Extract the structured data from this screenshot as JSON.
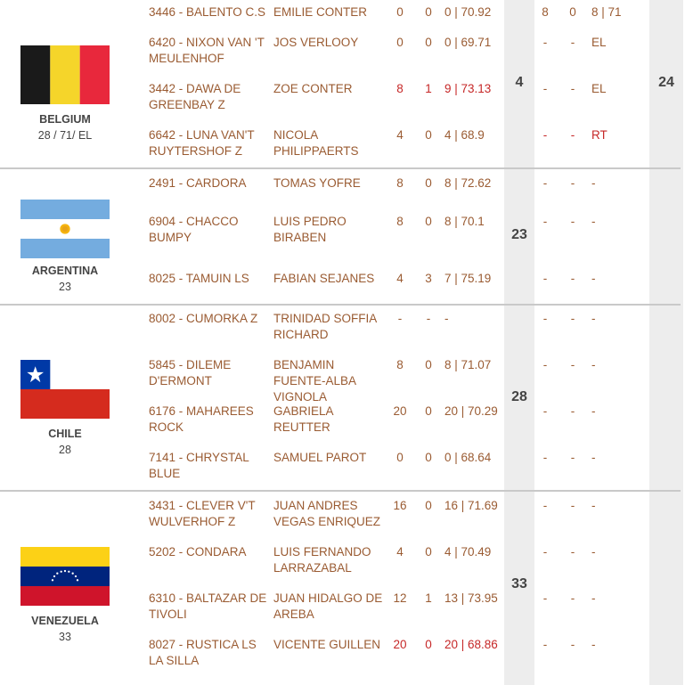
{
  "teams": [
    {
      "country": "BELGIUM",
      "score_line": "28 / 71/ EL",
      "round_score": "4",
      "total_score": "24",
      "riders": [
        {
          "horse": "3446 - BALENTO C.S",
          "rider": "EMILIE CONTER",
          "n1": "0",
          "n2": "0",
          "n3": "0 | 70.92",
          "m1": "8",
          "m2": "0",
          "m3": "8 | 71"
        },
        {
          "horse": "6420 - NIXON VAN 'T MEULENHOF",
          "rider": "JOS VERLOOY",
          "n1": "0",
          "n2": "0",
          "n3": "0 | 69.71",
          "m1": "-",
          "m2": "-",
          "m3": "EL"
        },
        {
          "horse": "3442 - DAWA DE GREENBAY Z",
          "rider": "ZOE CONTER",
          "n1": "8",
          "n2": "1",
          "n3": "9 | 73.13",
          "m1": "-",
          "m2": "-",
          "m3": "EL"
        },
        {
          "horse": "6642 - LUNA VAN'T RUYTERSHOF Z",
          "rider": "NICOLA PHILIPPAERTS",
          "n1": "4",
          "n2": "0",
          "n3": "4 | 68.9",
          "m1": "-",
          "m2": "-",
          "m3": "RT"
        }
      ]
    },
    {
      "country": "ARGENTINA",
      "score_line": "23",
      "round_score": "23",
      "riders": [
        {
          "horse": "2491 - CARDORA",
          "rider": "TOMAS YOFRE",
          "n1": "8",
          "n2": "0",
          "n3": "8 | 72.62",
          "m1": "-",
          "m2": "-",
          "m3": "-"
        },
        {
          "horse": "6904 - CHACCO BUMPY",
          "rider": "LUIS PEDRO BIRABEN",
          "n1": "8",
          "n2": "0",
          "n3": "8 | 70.1",
          "m1": "-",
          "m2": "-",
          "m3": "-"
        },
        {
          "horse": "8025 - TAMUIN LS",
          "rider": "FABIAN SEJANES",
          "n1": "4",
          "n2": "3",
          "n3": "7 | 75.19",
          "m1": "-",
          "m2": "-",
          "m3": "-"
        }
      ]
    },
    {
      "country": "CHILE",
      "score_line": "28",
      "round_score": "28",
      "riders": [
        {
          "horse": "8002 - CUMORKA Z",
          "rider": "TRINIDAD SOFFIA RICHARD",
          "n1": "-",
          "n2": "-",
          "n3": "-",
          "m1": "-",
          "m2": "-",
          "m3": "-"
        },
        {
          "horse": "5845 - DILEME D'ERMONT",
          "rider": "BENJAMIN FUENTE-ALBA VIGNOLA",
          "n1": "8",
          "n2": "0",
          "n3": "8 | 71.07",
          "m1": "-",
          "m2": "-",
          "m3": "-"
        },
        {
          "horse": "6176 - MAHAREES ROCK",
          "rider": "GABRIELA REUTTER",
          "n1": "20",
          "n2": "0",
          "n3": "20 | 70.29",
          "m1": "-",
          "m2": "-",
          "m3": "-"
        },
        {
          "horse": "7141 - CHRYSTAL BLUE",
          "rider": "SAMUEL PAROT",
          "n1": "0",
          "n2": "0",
          "n3": "0 | 68.64",
          "m1": "-",
          "m2": "-",
          "m3": "-"
        }
      ]
    },
    {
      "country": "VENEZUELA",
      "score_line": "33",
      "round_score": "33",
      "riders": [
        {
          "horse": "3431 - CLEVER V'T WULVERHOF Z",
          "rider": "JUAN ANDRES VEGAS ENRIQUEZ",
          "n1": "16",
          "n2": "0",
          "n3": "16 | 71.69",
          "m1": "-",
          "m2": "-",
          "m3": "-"
        },
        {
          "horse": "5202 - CONDARA",
          "rider": "LUIS FERNANDO LARRAZABAL",
          "n1": "4",
          "n2": "0",
          "n3": "4 | 70.49",
          "m1": "-",
          "m2": "-",
          "m3": "-"
        },
        {
          "horse": "6310 - BALTAZAR DE TIVOLI",
          "rider": "JUAN HIDALGO DE AREBA",
          "n1": "12",
          "n2": "1",
          "n3": "13 | 73.95",
          "m1": "-",
          "m2": "-",
          "m3": "-"
        },
        {
          "horse": "8027 - RUSTICA LS LA SILLA",
          "rider": "VICENTE GUILLEN",
          "n1": "20",
          "n2": "0",
          "n3": "20 | 68.86",
          "m1": "-",
          "m2": "-",
          "m3": "-"
        }
      ]
    }
  ],
  "colors": {
    "link_text": "#9a5b32",
    "dropped_score_red": "#c62828",
    "score_column_bg": "#ededed",
    "separator": "#c9c9c9"
  }
}
